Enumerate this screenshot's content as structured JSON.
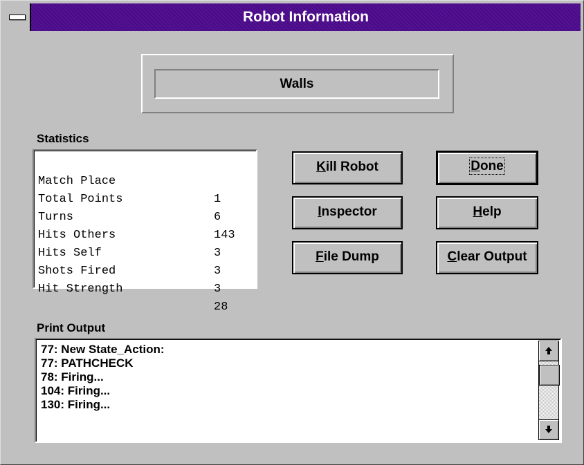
{
  "window": {
    "title": "Robot Information",
    "system_menu_icon": "system-menu-icon"
  },
  "robot_name": "Walls",
  "statistics": {
    "label": "Statistics",
    "rows": [
      {
        "name": "Match Place",
        "value": "1"
      },
      {
        "name": "Total Points",
        "value": "6"
      },
      {
        "name": "Turns",
        "value": "143"
      },
      {
        "name": "Hits Others",
        "value": "3"
      },
      {
        "name": "Hits Self",
        "value": "3"
      },
      {
        "name": "Shots Fired",
        "value": "3"
      },
      {
        "name": "Hit Strength",
        "value": "28"
      }
    ]
  },
  "buttons": {
    "kill_robot": {
      "mnemonic": "K",
      "rest": "ill Robot"
    },
    "done": {
      "mnemonic": "D",
      "rest": "one"
    },
    "inspector": {
      "mnemonic": "I",
      "rest": "nspector"
    },
    "help": {
      "mnemonic": "H",
      "rest": "elp"
    },
    "file_dump": {
      "mnemonic": "F",
      "rest": "ile Dump"
    },
    "clear_output": {
      "mnemonic": "C",
      "rest": "lear Output"
    }
  },
  "print_output": {
    "label": "Print Output",
    "lines": [
      "77: New State_Action:",
      "77: PATHCHECK",
      "78: Firing...",
      "104: Firing...",
      "130: Firing..."
    ],
    "scroll_position": 0.1
  },
  "colors": {
    "titlebar": "#4b0a8a",
    "face": "#c0c0c0"
  }
}
